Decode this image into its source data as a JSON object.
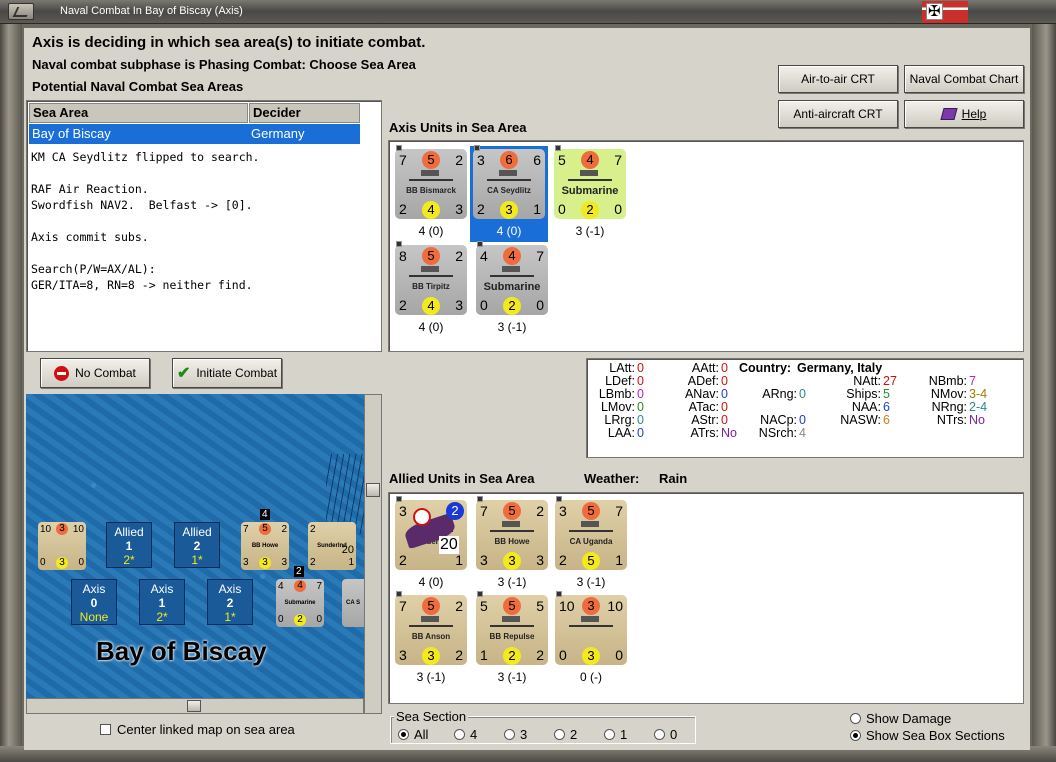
{
  "window": {
    "title": "Naval Combat In Bay of Biscay (Axis)"
  },
  "header": {
    "line1": "Axis is deciding in which sea area(s) to initiate combat.",
    "line2": "Naval combat subphase is Phasing Combat: Choose Sea Area",
    "line3": "Potential Naval Combat Sea Areas"
  },
  "buttons": {
    "air_to_air": "Air-to-air CRT",
    "naval_chart": "Naval Combat Chart",
    "anti_aircraft": "Anti-aircraft CRT",
    "help": "Help",
    "no_combat": "No Combat",
    "initiate": "Initiate Combat"
  },
  "table": {
    "col1": "Sea Area",
    "col2": "Decider",
    "row": {
      "area": "Bay of Biscay",
      "decider": "Germany"
    }
  },
  "log": "KM CA Seydlitz flipped to search.\n\nRAF Air Reaction.\nSwordfish NAV2.  Belfast -> [0].\n\nAxis commit subs.\n\nSearch(P/W=AX/AL):\nGER/ITA=8, RN=8 -> neither find.",
  "axis_units": {
    "title": "Axis Units in Sea Area",
    "units": [
      {
        "name": "BB Bismarck",
        "tl": "7",
        "tc": "5",
        "tr": "2",
        "bl": "2",
        "bc": "4",
        "br": "3",
        "cap": "4 (0)"
      },
      {
        "name": "CA Seydlitz",
        "tl": "3",
        "tc": "6",
        "tr": "6",
        "bl": "2",
        "bc": "3",
        "br": "1",
        "cap": "4 (0)"
      },
      {
        "name": "Submarine",
        "tl": "5",
        "tc": "4",
        "tr": "7",
        "bl": "0",
        "bc": "2",
        "br": "0",
        "cap": "3 (-1)"
      },
      {
        "name": "BB Tirpitz",
        "tl": "8",
        "tc": "5",
        "tr": "2",
        "bl": "2",
        "bc": "4",
        "br": "3",
        "cap": "4 (0)"
      },
      {
        "name": "Submarine",
        "tl": "4",
        "tc": "4",
        "tr": "7",
        "bl": "0",
        "bc": "2",
        "br": "0",
        "cap": "3 (-1)"
      }
    ]
  },
  "allied_units": {
    "title": "Allied Units in Sea Area",
    "weather_label": "Weather:",
    "weather": "Rain",
    "units": [
      {
        "name": "Sunderlnd",
        "tl": "3",
        "tc": "",
        "tr": "2",
        "bl": "2",
        "bc": "",
        "br": "1",
        "mid": "20",
        "cap": "4 (0)"
      },
      {
        "name": "BB Howe",
        "tl": "7",
        "tc": "5",
        "tr": "2",
        "bl": "3",
        "bc": "3",
        "br": "3",
        "cap": "3 (-1)"
      },
      {
        "name": "CA Uganda",
        "tl": "3",
        "tc": "5",
        "tr": "7",
        "bl": "2",
        "bc": "5",
        "br": "1",
        "cap": "3 (-1)"
      },
      {
        "name": "BB Anson",
        "tl": "7",
        "tc": "5",
        "tr": "2",
        "bl": "3",
        "bc": "3",
        "br": "2",
        "cap": "3 (-1)"
      },
      {
        "name": "BB Repulse",
        "tl": "5",
        "tc": "5",
        "tr": "5",
        "bl": "1",
        "bc": "2",
        "br": "2",
        "cap": "3 (-1)"
      },
      {
        "name": "",
        "tl": "10",
        "tc": "3",
        "tr": "10",
        "bl": "0",
        "bc": "3",
        "br": "0",
        "cap": "0 (-)"
      }
    ]
  },
  "stats": {
    "country_label": "Country:",
    "country": "Germany, Italy",
    "items": [
      {
        "k": "LAtt:",
        "v": "0",
        "c": "#d01010"
      },
      {
        "k": "LDef:",
        "v": "0",
        "c": "#d01010"
      },
      {
        "k": "LBmb:",
        "v": "0",
        "c": "#c020c0"
      },
      {
        "k": "LMov:",
        "v": "0",
        "c": "#2a8a2a"
      },
      {
        "k": "LRrg:",
        "v": "0",
        "c": "#2a8a8a"
      },
      {
        "k": "LAA:",
        "v": "0",
        "c": "#2040d0"
      },
      {
        "k": "AAtt:",
        "v": "0",
        "c": "#d01010"
      },
      {
        "k": "ADef:",
        "v": "0",
        "c": "#d01010"
      },
      {
        "k": "ANav:",
        "v": "0",
        "c": "#2040d0"
      },
      {
        "k": "ATac:",
        "v": "0",
        "c": "#d01010"
      },
      {
        "k": "AStr:",
        "v": "0",
        "c": "#d01010"
      },
      {
        "k": "ATrs:",
        "v": "No",
        "c": "#8020a0"
      },
      {
        "k": "ARng:",
        "v": "0",
        "c": "#2a8a8a"
      },
      {
        "k": "NACp:",
        "v": "0",
        "c": "#2040d0"
      },
      {
        "k": "NSrch:",
        "v": "4",
        "c": "#888888"
      },
      {
        "k": "NAtt:",
        "v": "27",
        "c": "#d01010"
      },
      {
        "k": "Ships:",
        "v": "5",
        "c": "#2a8a2a"
      },
      {
        "k": "NAA:",
        "v": "6",
        "c": "#2040d0"
      },
      {
        "k": "NASW:",
        "v": "6",
        "c": "#d08020"
      },
      {
        "k": "NBmb:",
        "v": "7",
        "c": "#c020c0"
      },
      {
        "k": "NMov:",
        "v": "3-4",
        "c": "#a08000"
      },
      {
        "k": "NRng:",
        "v": "2-4",
        "c": "#2a8a8a"
      },
      {
        "k": "NTrs:",
        "v": "No",
        "c": "#8020a0"
      }
    ]
  },
  "map": {
    "sea_name": "Bay of Biscay",
    "allied_boxes": [
      {
        "t": "Allied",
        "n": "1",
        "s": "2*"
      },
      {
        "t": "Allied",
        "n": "2",
        "s": "1*"
      }
    ],
    "axis_boxes": [
      {
        "t": "Axis",
        "n": "0",
        "s": "None"
      },
      {
        "t": "Axis",
        "n": "1",
        "s": "2*"
      },
      {
        "t": "Axis",
        "n": "2",
        "s": "1*"
      }
    ],
    "counter_labels": {
      "howe": "BB Howe",
      "sub": "Submarine",
      "sund": "Sunderlnd",
      "ca": "CA S",
      "stack4": "4",
      "stack2": "2"
    },
    "c1": {
      "tl": "10",
      "tc": "3",
      "tr": "10",
      "bl": "0",
      "bc": "3",
      "br": "0"
    },
    "c2": {
      "tl": "7",
      "tc": "5",
      "tr": "2",
      "bl": "3",
      "bc": "3",
      "br": "3"
    },
    "c3": {
      "tl": "4",
      "tc": "4",
      "tr": "7",
      "bl": "0",
      "bc": "2",
      "br": "0"
    },
    "c4": {
      "tl": "2",
      "mid": "20",
      "bl": "2",
      "br": "1"
    }
  },
  "center_map": "Center linked map on sea area",
  "sea_section": {
    "label": "Sea Section",
    "options": [
      "All",
      "4",
      "3",
      "2",
      "1",
      "0"
    ],
    "selected": "All"
  },
  "display_opts": {
    "damage": "Show Damage",
    "sections": "Show Sea Box Sections"
  }
}
